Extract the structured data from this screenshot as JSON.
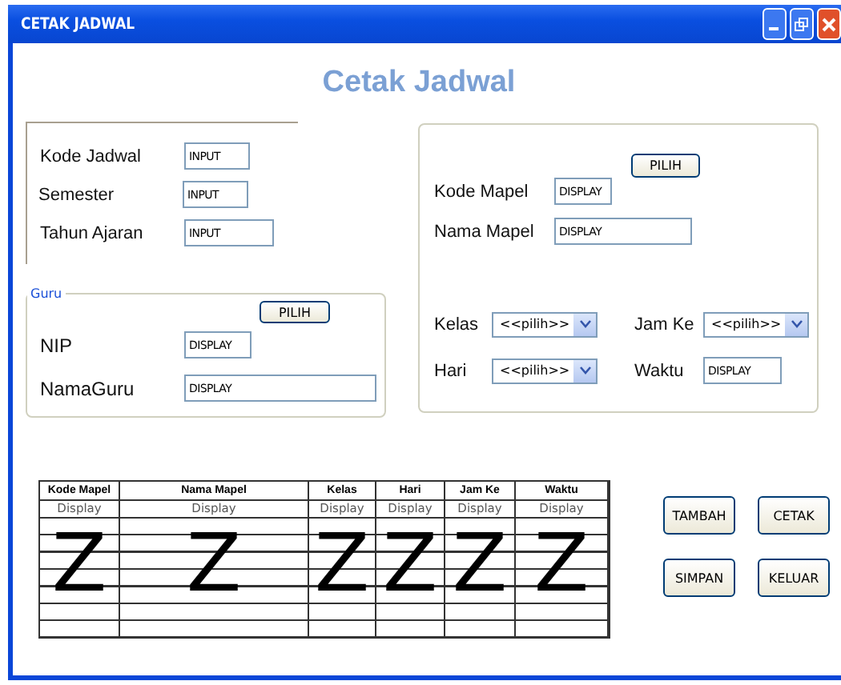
{
  "window": {
    "title": "CETAK JADWAL"
  },
  "heading": "Cetak Jadwal",
  "main_fields": [
    {
      "label": "Kode Jadwal",
      "value": "INPUT"
    },
    {
      "label": "Semester",
      "value": "INPUT"
    },
    {
      "label": "Tahun Ajaran",
      "value": "INPUT"
    }
  ],
  "guru": {
    "title": "Guru",
    "button": "PILIH",
    "fields": [
      {
        "label": "NIP",
        "value": "DISPLAY"
      },
      {
        "label": "NamaGuru",
        "value": "DISPLAY"
      }
    ]
  },
  "mapel": {
    "button": "PILIH",
    "fields": [
      {
        "label": "Kode Mapel",
        "value": "DISPLAY"
      },
      {
        "label": "Nama Mapel",
        "value": "DISPLAY"
      }
    ],
    "options": [
      {
        "kind": "select",
        "label": "Kelas",
        "value": "<<pilih>>"
      },
      {
        "kind": "select",
        "label": "Jam Ke",
        "value": "<<pilih>>"
      },
      {
        "kind": "select",
        "label": "Hari",
        "value": "<<pilih>>"
      },
      {
        "kind": "text",
        "label": "Waktu",
        "value": "DISPLAY"
      }
    ]
  },
  "table": {
    "columns": [
      "Kode Mapel",
      "Nama Mapel",
      "Kelas",
      "Hari",
      "Jam Ke",
      "Waktu"
    ],
    "display_row": [
      "Display",
      "Display",
      "Display",
      "Display",
      "Display",
      "Display"
    ],
    "marker_row": [
      "Z",
      "Z",
      "Z",
      "Z",
      "Z",
      "Z"
    ]
  },
  "buttons": [
    "TAMBAH",
    "CETAK",
    "SIMPAN",
    "KELUAR"
  ]
}
